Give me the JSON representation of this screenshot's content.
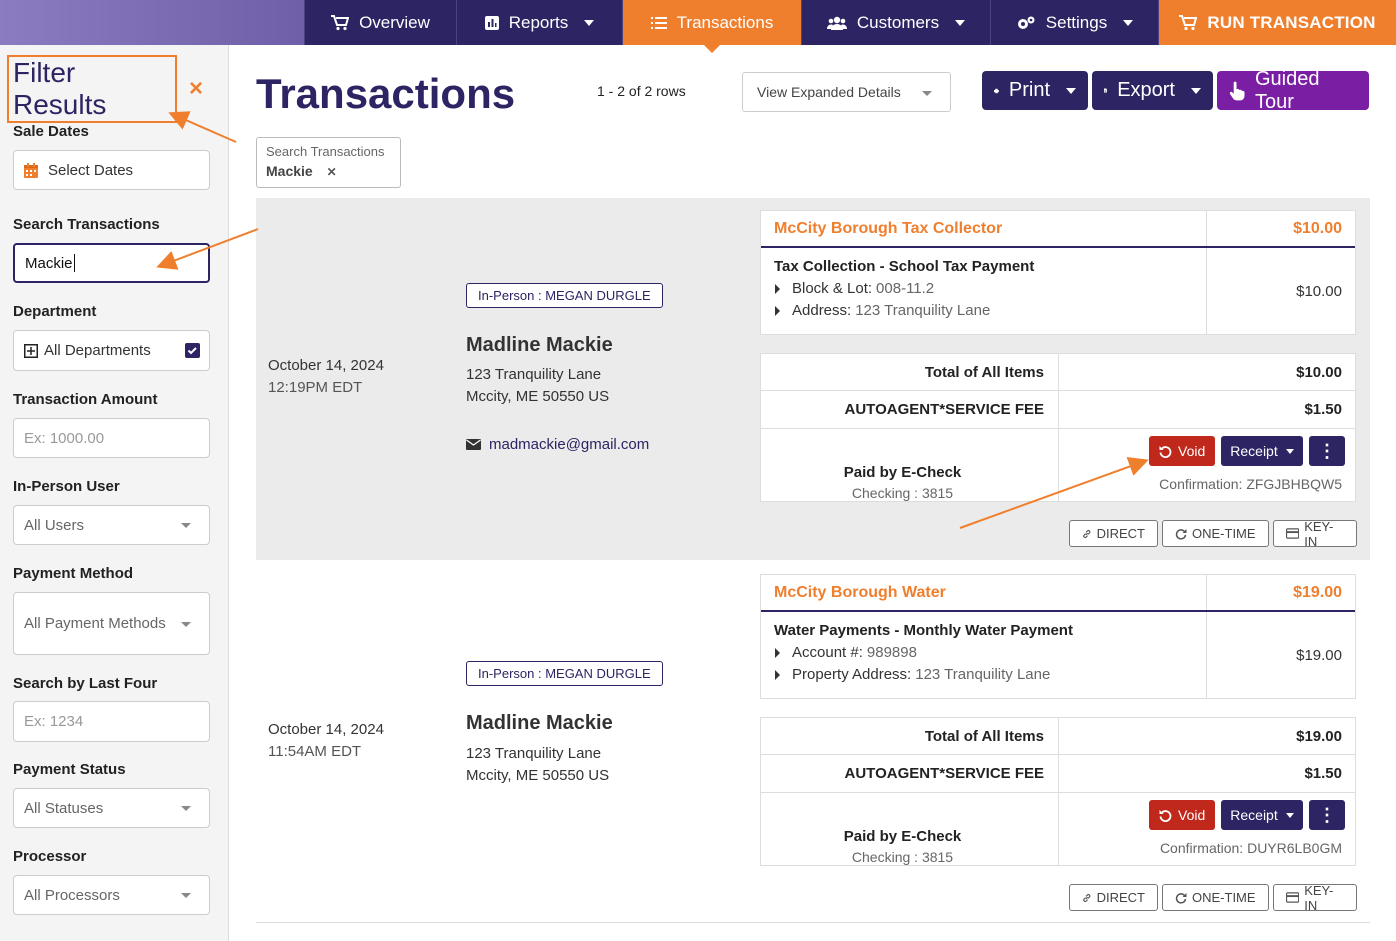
{
  "nav": {
    "overview": "Overview",
    "reports": "Reports",
    "transactions": "Transactions",
    "customers": "Customers",
    "settings": "Settings",
    "run": "RUN TRANSACTION"
  },
  "sidebar": {
    "title": "Filter Results",
    "close": "×",
    "sale_dates_label": "Sale Dates",
    "sale_dates_value": "Select Dates",
    "search_label": "Search Transactions",
    "search_value": "Mackie",
    "department_label": "Department",
    "department_value": "All Departments",
    "amount_label": "Transaction Amount",
    "amount_placeholder": "Ex: 1000.00",
    "user_label": "In-Person User",
    "user_value": "All Users",
    "method_label": "Payment Method",
    "method_value": "All Payment Methods",
    "lastfour_label": "Search by Last Four",
    "lastfour_placeholder": "Ex: 1234",
    "status_label": "Payment Status",
    "status_value": "All Statuses",
    "processor_label": "Processor",
    "processor_value": "All Processors"
  },
  "header": {
    "title": "Transactions",
    "rows": "1 - 2 of 2 rows",
    "expanded": "View Expanded Details",
    "print": "Print",
    "export": "Export",
    "tour": "Guided Tour"
  },
  "chip": {
    "label": "Search Transactions",
    "value": "Mackie",
    "remove": "✕"
  },
  "transactions": [
    {
      "date": "October 14, 2024",
      "time": "12:19PM EDT",
      "badge": "In-Person : MEGAN DURGLE",
      "name": "Madline Mackie",
      "addr1": "123 Tranquility Lane",
      "addr2": "Mccity, ME 50550 US",
      "email": "madmackie@gmail.com",
      "payee": "McCity Borough Tax Collector",
      "payee_amount": "$10.00",
      "service": "Tax Collection - School Tax Payment",
      "details": [
        {
          "k": "Block & Lot:",
          "v": "008-11.2"
        },
        {
          "k": "Address:",
          "v": "123 Tranquility Lane"
        }
      ],
      "line_amount": "$10.00",
      "total_label": "Total of All Items",
      "total": "$10.00",
      "fee_label": "AUTOAGENT*SERVICE FEE",
      "fee": "$1.50",
      "paid_label": "Paid by E-Check",
      "paid_sub": "Checking : 3815",
      "void": "Void",
      "receipt": "Receipt",
      "more": "⋮",
      "confirmation": "Confirmation: ZFGJBHBQW5",
      "tags": [
        "DIRECT",
        "ONE-TIME",
        "KEY-IN"
      ]
    },
    {
      "date": "October 14, 2024",
      "time": "11:54AM EDT",
      "badge": "In-Person : MEGAN DURGLE",
      "name": "Madline Mackie",
      "addr1": "123 Tranquility Lane",
      "addr2": "Mccity, ME 50550 US",
      "payee": "McCity Borough Water",
      "payee_amount": "$19.00",
      "service": "Water Payments - Monthly Water Payment",
      "details": [
        {
          "k": "Account #:",
          "v": "989898"
        },
        {
          "k": "Property Address:",
          "v": "123 Tranquility Lane"
        }
      ],
      "line_amount": "$19.00",
      "total_label": "Total of All Items",
      "total": "$19.00",
      "fee_label": "AUTOAGENT*SERVICE FEE",
      "fee": "$1.50",
      "paid_label": "Paid by E-Check",
      "paid_sub": "Checking : 3815",
      "void": "Void",
      "receipt": "Receipt",
      "more": "⋮",
      "confirmation": "Confirmation: DUYR6LB0GM",
      "tags": [
        "DIRECT",
        "ONE-TIME",
        "KEY-IN"
      ]
    }
  ],
  "colors": {
    "navy": "#2c2463",
    "orange": "#f07f2d",
    "red": "#c0281b",
    "purple": "#7a1ea3"
  }
}
